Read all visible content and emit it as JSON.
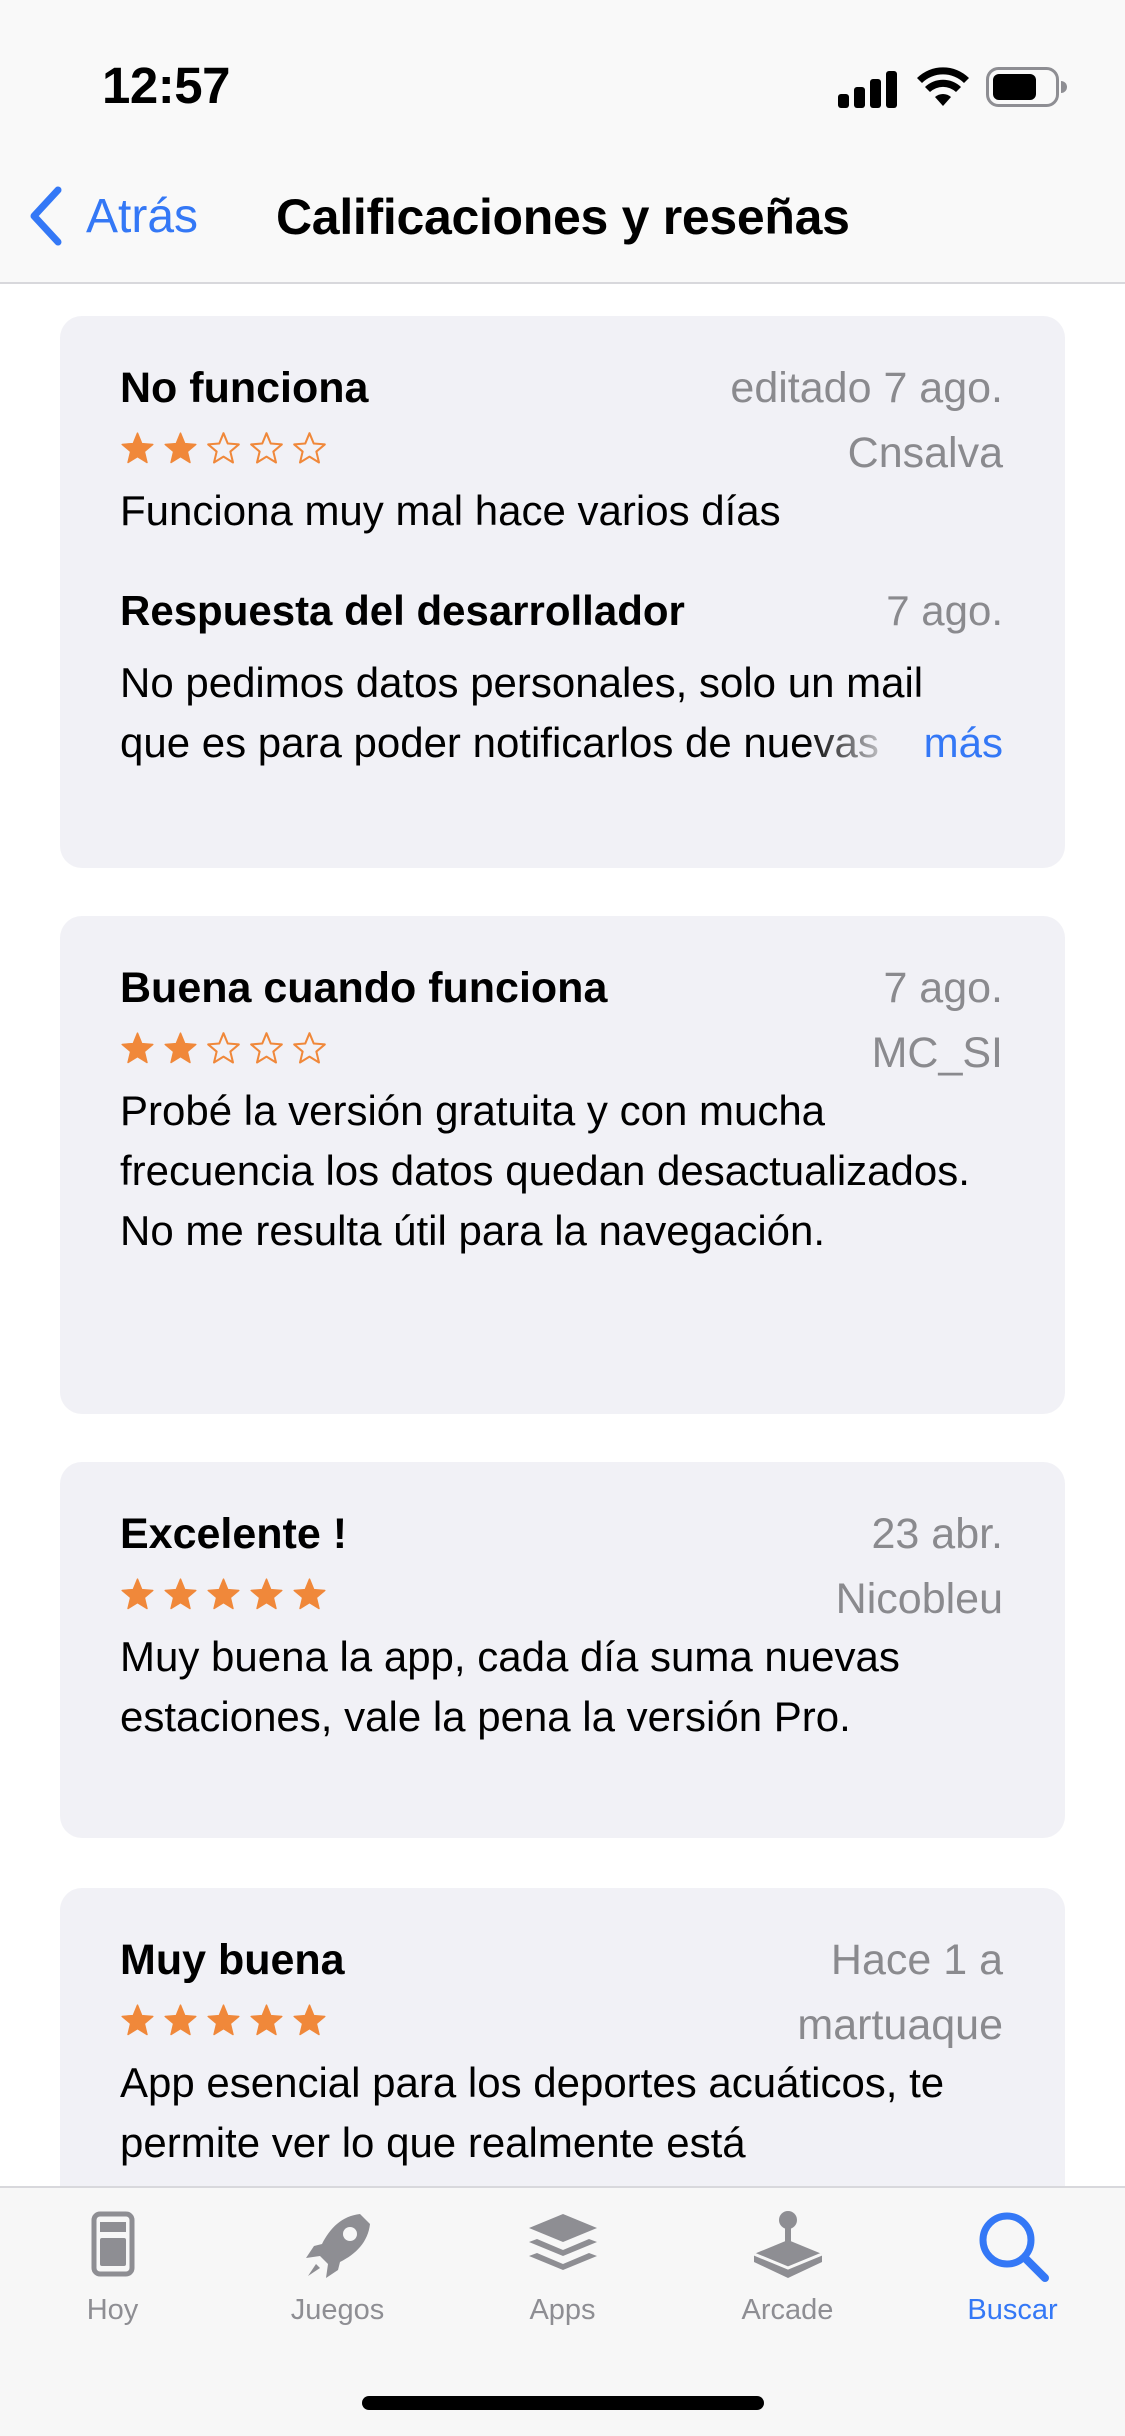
{
  "status_bar": {
    "time": "12:57"
  },
  "nav": {
    "back_label": "Atrás",
    "title": "Calificaciones y reseñas"
  },
  "colors": {
    "accent": "#3478f6",
    "star": "#f0883a",
    "card_bg": "#f1f1f6",
    "secondary_text": "#8a8a8e"
  },
  "reviews": [
    {
      "title": "No funciona",
      "date": "editado 7 ago.",
      "author": "Cnsalva",
      "rating": 2,
      "body": "Funciona muy mal hace varios días",
      "developer_response": {
        "title": "Respuesta del desarrollador",
        "date": "7 ago.",
        "line1": "No pedimos datos personales, solo un mail",
        "line2": "que es para poder notificarlos de nuevas",
        "more_label": "más"
      }
    },
    {
      "title": "Buena cuando funciona",
      "date": "7 ago.",
      "author": "MC_SI",
      "rating": 2,
      "body": "Probé la versión gratuita y con mucha frecuencia los datos quedan desactualizados. No me resulta útil para la navegación."
    },
    {
      "title": "Excelente !",
      "date": "23 abr.",
      "author": "Nicobleu",
      "rating": 5,
      "body": "Muy buena la app, cada día suma nuevas estaciones, vale la pena la versión Pro."
    },
    {
      "title": "Muy buena",
      "date": "Hace 1 a",
      "author": "martuaque",
      "rating": 5,
      "body": "App esencial para los deportes acuáticos, te permite ver lo que realmente está"
    }
  ],
  "tab_bar": {
    "tabs": [
      {
        "label": "Hoy",
        "icon": "today-icon",
        "active": false
      },
      {
        "label": "Juegos",
        "icon": "rocket-icon",
        "active": false
      },
      {
        "label": "Apps",
        "icon": "apps-stack-icon",
        "active": false
      },
      {
        "label": "Arcade",
        "icon": "joystick-icon",
        "active": false
      },
      {
        "label": "Buscar",
        "icon": "search-icon",
        "active": true
      }
    ]
  }
}
